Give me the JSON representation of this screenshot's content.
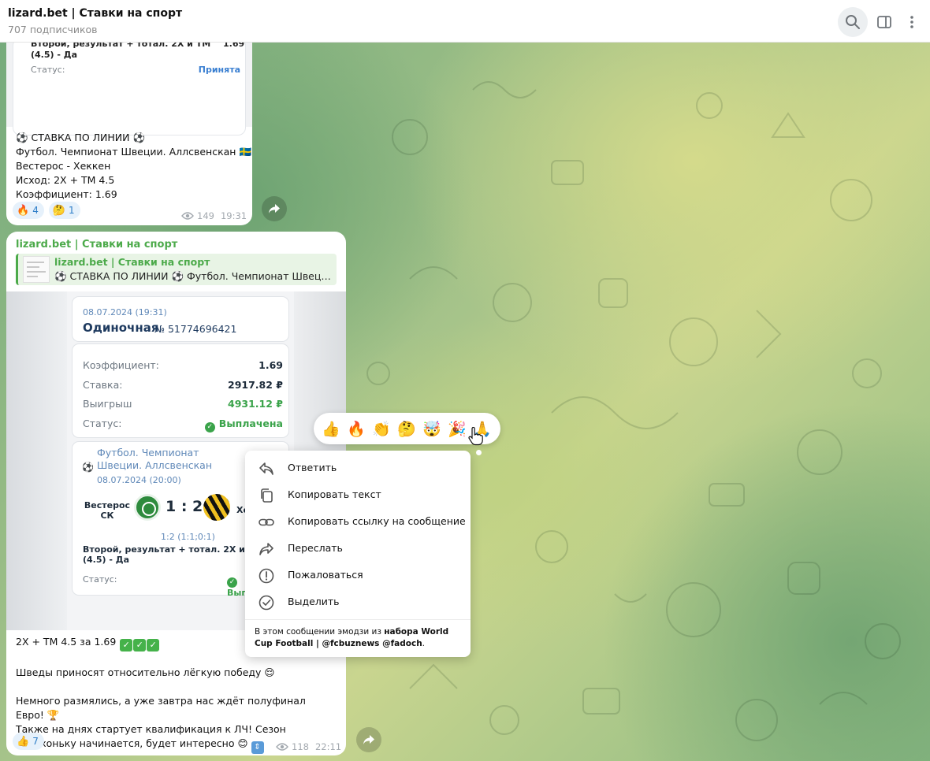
{
  "header": {
    "title": "lizard.bet | Ставки на спорт",
    "subscribers": "707 подписчиков",
    "icons": [
      "search-icon",
      "side-panel-icon",
      "more-vertical-icon"
    ]
  },
  "message1": {
    "slip_bet": "Второй, результат + тотал. 2Х и ТМ (4.5) - Да",
    "slip_coef": "1.69",
    "slip_status_label": "Статус:",
    "slip_status_value": "Принята",
    "lines": [
      "⚽ СТАВКА ПО ЛИНИИ ⚽",
      "Футбол. Чемпионат Швеции. Аллсвенскан 🇸🇪",
      "Вестерос - Хеккен",
      "Исход: 2Х + ТМ 4.5",
      "Коэффициент: 1.69"
    ],
    "reactions": [
      {
        "emoji": "🔥",
        "count": "4"
      },
      {
        "emoji": "🤔",
        "count": "1"
      }
    ],
    "views": "149",
    "time": "19:31"
  },
  "message2": {
    "author": "lizard.bet | Ставки на спорт",
    "reply": {
      "author": "lizard.bet | Ставки на спорт",
      "text": "⚽ СТАВКА ПО ЛИНИИ ⚽ Футбол. Чемпионат Швеции. Аллсвенскан 🇸🇪 Вестерос - Хеккен"
    },
    "slip": {
      "date": "08.07.2024 (19:31)",
      "kind": "Одиночная",
      "number": "№ 51774696421",
      "rows": [
        {
          "label": "Коэффициент:",
          "value": "1.69"
        },
        {
          "label": "Ставка:",
          "value": "2917.82 ₽"
        },
        {
          "label": "Выигрыш",
          "value": "4931.12 ₽"
        },
        {
          "label": "Статус:",
          "value": "Выплачена"
        }
      ],
      "event": {
        "sport": "Футбол. Чемпионат Швеции. Аллсвенскан",
        "date": "08.07.2024 (20:00)",
        "team1": "Вестерос СК",
        "score": "1 : 2",
        "team2": "Хеккен",
        "half_score": "1:2 (1:1;0:1)",
        "bet": "Второй, результат + тотал. 2Х и ТМ (4.5) - Да",
        "status_label": "Статус:",
        "status_value": "Выплачена"
      }
    },
    "text": {
      "line1": "2Х + ТМ 4.5 за 1.69",
      "line2": "Шведы приносят относительно лёгкую победу 😌",
      "line3": "Немного размялись, а уже завтра нас ждёт полуфинал Евро!",
      "line4": "Также на днях стартует квалификация к ЛЧ! Сезон потихоньку начинается, будет интересно 😊"
    },
    "reactions": [
      {
        "emoji": "👍",
        "count": "7"
      }
    ],
    "views": "118",
    "time": "22:11"
  },
  "reaction_bar": [
    "👍",
    "🔥",
    "👏",
    "🤔",
    "🤯",
    "🎉",
    "🙏"
  ],
  "context_menu": {
    "items": [
      {
        "label": "Ответить",
        "icon": "reply-icon"
      },
      {
        "label": "Копировать текст",
        "icon": "copy-icon"
      },
      {
        "label": "Копировать ссылку на сообщение",
        "icon": "link-icon"
      },
      {
        "label": "Переслать",
        "icon": "forward-icon"
      },
      {
        "label": "Пожаловаться",
        "icon": "report-icon"
      },
      {
        "label": "Выделить",
        "icon": "select-icon"
      }
    ],
    "footer_prefix": "В этом сообщении эмодзи из",
    "footer_link": "набора World Cup Football | @fcbuznews @fadoch",
    "footer_suffix": "."
  },
  "colors": {
    "accent_green": "#4caa4a",
    "link_blue": "#2e7ec8",
    "paid_green": "#3aa34a",
    "slip_blue": "#5f88b8"
  }
}
